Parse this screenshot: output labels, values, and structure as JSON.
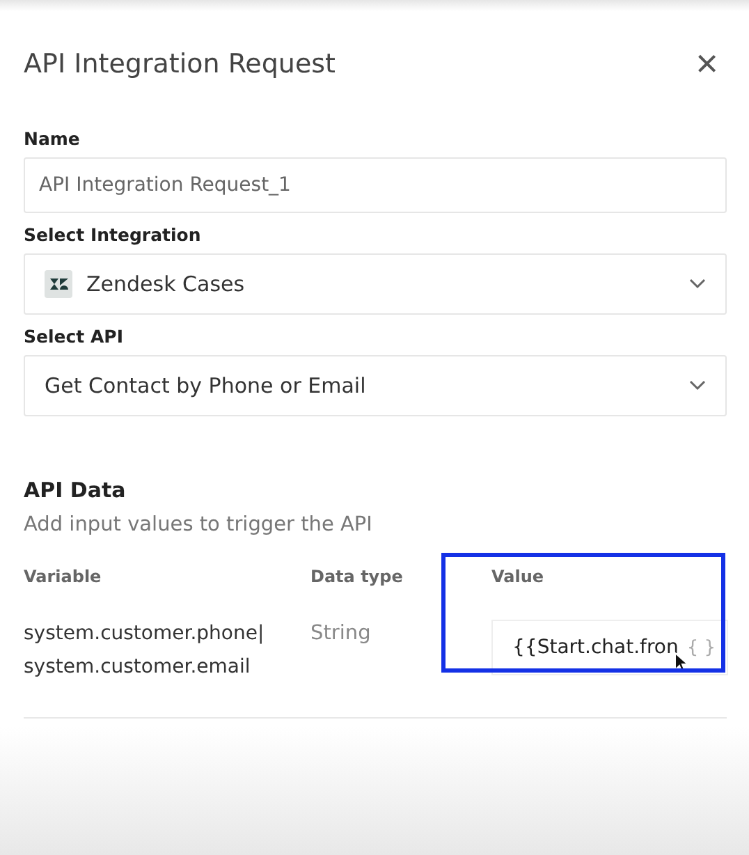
{
  "dialog": {
    "title": "API Integration Request",
    "close": "×"
  },
  "fields": [
    {
      "kind": "text",
      "label": "Name",
      "value": "API Integration Request_1"
    },
    {
      "kind": "select",
      "label": "Select Integration",
      "value": "Zendesk Cases",
      "logo": true
    },
    {
      "kind": "select",
      "label": "Select API",
      "value": "Get Contact by Phone or Email",
      "logo": false
    }
  ],
  "api_data": {
    "title": "API Data",
    "subtitle": "Add input values to trigger the API",
    "columns": [
      "Variable",
      "Data type",
      "Value"
    ],
    "value_column_highlighted": true,
    "rows": [
      {
        "variable": "system.customer.phone|system.customer.email",
        "data_type": "String",
        "value": "{{Start.chat.fron",
        "insert_symbol": "{ }"
      }
    ]
  }
}
